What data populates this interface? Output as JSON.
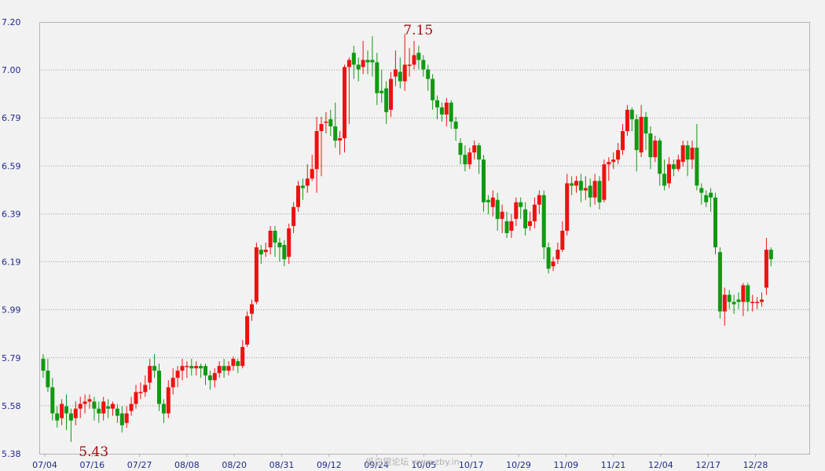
{
  "chart_data": {
    "type": "candlestick",
    "ylim": [
      5.38,
      7.2
    ],
    "yticks": [
      "7.20",
      "7.00",
      "6.79",
      "6.59",
      "6.39",
      "6.19",
      "5.99",
      "5.79",
      "5.58",
      "5.38"
    ],
    "xticks": [
      "07/04",
      "07/16",
      "07/27",
      "08/08",
      "08/20",
      "08/31",
      "09/12",
      "09/24",
      "10/05",
      "10/17",
      "10/29",
      "11/09",
      "11/21",
      "12/04",
      "12/17",
      "12/28"
    ],
    "grid": true,
    "up_color": "#ee1111",
    "down_color": "#119911",
    "annotations": [
      {
        "text": "7.15",
        "x": 77,
        "y": 7.15
      },
      {
        "text": "5.43",
        "x": 7,
        "y": 5.43
      }
    ],
    "candles": [
      [
        5.78,
        5.73,
        5.8,
        5.7
      ],
      [
        5.73,
        5.66,
        5.78,
        5.64
      ],
      [
        5.66,
        5.55,
        5.7,
        5.52
      ],
      [
        5.55,
        5.52,
        5.58,
        5.49
      ],
      [
        5.53,
        5.59,
        5.61,
        5.5
      ],
      [
        5.58,
        5.55,
        5.63,
        5.48
      ],
      [
        5.55,
        5.52,
        5.57,
        5.43
      ],
      [
        5.53,
        5.57,
        5.6,
        5.5
      ],
      [
        5.57,
        5.59,
        5.62,
        5.53
      ],
      [
        5.59,
        5.6,
        5.63,
        5.55
      ],
      [
        5.6,
        5.61,
        5.63,
        5.57
      ],
      [
        5.6,
        5.57,
        5.62,
        5.52
      ],
      [
        5.57,
        5.55,
        5.6,
        5.51
      ],
      [
        5.55,
        5.6,
        5.62,
        5.52
      ],
      [
        5.58,
        5.57,
        5.61,
        5.53
      ],
      [
        5.57,
        5.59,
        5.6,
        5.54
      ],
      [
        5.57,
        5.54,
        5.59,
        5.51
      ],
      [
        5.55,
        5.5,
        5.58,
        5.47
      ],
      [
        5.51,
        5.55,
        5.58,
        5.49
      ],
      [
        5.56,
        5.59,
        5.62,
        5.54
      ],
      [
        5.59,
        5.64,
        5.67,
        5.57
      ],
      [
        5.64,
        5.64,
        5.68,
        5.61
      ],
      [
        5.64,
        5.67,
        5.71,
        5.62
      ],
      [
        5.68,
        5.75,
        5.78,
        5.65
      ],
      [
        5.75,
        5.73,
        5.8,
        5.7
      ],
      [
        5.73,
        5.59,
        5.76,
        5.56
      ],
      [
        5.59,
        5.55,
        5.61,
        5.51
      ],
      [
        5.55,
        5.66,
        5.69,
        5.53
      ],
      [
        5.66,
        5.7,
        5.74,
        5.63
      ],
      [
        5.7,
        5.73,
        5.75,
        5.66
      ],
      [
        5.73,
        5.75,
        5.78,
        5.69
      ],
      [
        5.75,
        5.75,
        5.77,
        5.7
      ],
      [
        5.75,
        5.74,
        5.78,
        5.71
      ],
      [
        5.74,
        5.75,
        5.77,
        5.71
      ],
      [
        5.75,
        5.74,
        5.76,
        5.7
      ],
      [
        5.75,
        5.71,
        5.76,
        5.67
      ],
      [
        5.71,
        5.69,
        5.73,
        5.65
      ],
      [
        5.69,
        5.72,
        5.74,
        5.66
      ],
      [
        5.72,
        5.75,
        5.77,
        5.7
      ],
      [
        5.75,
        5.73,
        5.78,
        5.7
      ],
      [
        5.73,
        5.75,
        5.77,
        5.71
      ],
      [
        5.75,
        5.78,
        5.79,
        5.73
      ],
      [
        5.77,
        5.75,
        5.78,
        5.72
      ],
      [
        5.75,
        5.83,
        5.86,
        5.74
      ],
      [
        5.84,
        5.96,
        5.98,
        5.83
      ],
      [
        5.97,
        6.01,
        6.03,
        5.94
      ],
      [
        6.02,
        6.25,
        6.27,
        6.01
      ],
      [
        6.24,
        6.22,
        6.26,
        6.18
      ],
      [
        6.23,
        6.24,
        6.27,
        6.21
      ],
      [
        6.25,
        6.32,
        6.34,
        6.22
      ],
      [
        6.32,
        6.27,
        6.34,
        6.21
      ],
      [
        6.27,
        6.25,
        6.29,
        6.19
      ],
      [
        6.26,
        6.2,
        6.28,
        6.17
      ],
      [
        6.21,
        6.33,
        6.35,
        6.18
      ],
      [
        6.34,
        6.42,
        6.44,
        6.31
      ],
      [
        6.42,
        6.51,
        6.53,
        6.4
      ],
      [
        6.51,
        6.5,
        6.54,
        6.45
      ],
      [
        6.51,
        6.54,
        6.6,
        6.48
      ],
      [
        6.54,
        6.58,
        6.64,
        6.53
      ],
      [
        6.58,
        6.74,
        6.8,
        6.48
      ],
      [
        6.74,
        6.77,
        6.8,
        6.55
      ],
      [
        6.78,
        6.78,
        6.82,
        6.73
      ],
      [
        6.79,
        6.76,
        6.83,
        6.72
      ],
      [
        6.76,
        6.7,
        6.86,
        6.67
      ],
      [
        6.7,
        6.71,
        6.74,
        6.64
      ],
      [
        6.71,
        7.01,
        7.02,
        6.65
      ],
      [
        7.01,
        7.04,
        7.05,
        6.77
      ],
      [
        7.07,
        7.02,
        7.1,
        6.96
      ],
      [
        7.02,
        7.0,
        7.05,
        6.95
      ],
      [
        7.01,
        7.04,
        7.12,
        6.98
      ],
      [
        7.04,
        7.03,
        7.08,
        6.98
      ],
      [
        7.04,
        7.03,
        7.14,
        6.97
      ],
      [
        7.03,
        6.9,
        7.07,
        6.85
      ],
      [
        6.91,
        6.9,
        7.0,
        6.86
      ],
      [
        6.92,
        6.82,
        6.95,
        6.77
      ],
      [
        6.83,
        6.96,
        6.99,
        6.8
      ],
      [
        6.97,
        7.0,
        7.08,
        6.93
      ],
      [
        6.99,
        6.95,
        7.05,
        6.92
      ],
      [
        6.95,
        7.02,
        7.15,
        6.91
      ],
      [
        7.02,
        7.02,
        7.09,
        6.97
      ],
      [
        7.02,
        7.06,
        7.12,
        7.0
      ],
      [
        7.07,
        7.04,
        7.1,
        7.0
      ],
      [
        7.04,
        7.0,
        7.06,
        6.97
      ],
      [
        7.0,
        6.96,
        7.02,
        6.91
      ],
      [
        6.96,
        6.87,
        6.98,
        6.83
      ],
      [
        6.87,
        6.84,
        6.89,
        6.79
      ],
      [
        6.84,
        6.81,
        6.86,
        6.78
      ],
      [
        6.81,
        6.86,
        6.88,
        6.76
      ],
      [
        6.86,
        6.78,
        6.87,
        6.75
      ],
      [
        6.78,
        6.75,
        6.8,
        6.7
      ],
      [
        6.69,
        6.64,
        6.71,
        6.6
      ],
      [
        6.64,
        6.6,
        6.68,
        6.57
      ],
      [
        6.6,
        6.65,
        6.67,
        6.58
      ],
      [
        6.65,
        6.68,
        6.7,
        6.62
      ],
      [
        6.68,
        6.62,
        6.69,
        6.56
      ],
      [
        6.62,
        6.44,
        6.64,
        6.4
      ],
      [
        6.45,
        6.44,
        6.47,
        6.39
      ],
      [
        6.42,
        6.46,
        6.49,
        6.38
      ],
      [
        6.45,
        6.37,
        6.48,
        6.32
      ],
      [
        6.37,
        6.4,
        6.43,
        6.31
      ],
      [
        6.36,
        6.31,
        6.4,
        6.29
      ],
      [
        6.32,
        6.36,
        6.39,
        6.29
      ],
      [
        6.37,
        6.44,
        6.46,
        6.34
      ],
      [
        6.44,
        6.42,
        6.46,
        6.37
      ],
      [
        6.41,
        6.33,
        6.44,
        6.3
      ],
      [
        6.34,
        6.36,
        6.4,
        6.32
      ],
      [
        6.36,
        6.43,
        6.46,
        6.33
      ],
      [
        6.43,
        6.47,
        6.49,
        6.39
      ],
      [
        6.47,
        6.25,
        6.49,
        6.2
      ],
      [
        6.25,
        6.16,
        6.27,
        6.14
      ],
      [
        6.17,
        6.19,
        6.21,
        6.15
      ],
      [
        6.2,
        6.24,
        6.27,
        6.18
      ],
      [
        6.24,
        6.32,
        6.36,
        6.23
      ],
      [
        6.32,
        6.52,
        6.56,
        6.3
      ],
      [
        6.52,
        6.51,
        6.55,
        6.47
      ],
      [
        6.51,
        6.53,
        6.55,
        6.48
      ],
      [
        6.53,
        6.49,
        6.56,
        6.44
      ],
      [
        6.49,
        6.5,
        6.55,
        6.45
      ],
      [
        6.51,
        6.46,
        6.54,
        6.42
      ],
      [
        6.46,
        6.53,
        6.56,
        6.43
      ],
      [
        6.53,
        6.44,
        6.55,
        6.41
      ],
      [
        6.45,
        6.6,
        6.62,
        6.44
      ],
      [
        6.6,
        6.61,
        6.63,
        6.53
      ],
      [
        6.61,
        6.62,
        6.65,
        6.58
      ],
      [
        6.62,
        6.66,
        6.69,
        6.6
      ],
      [
        6.66,
        6.74,
        6.77,
        6.64
      ],
      [
        6.74,
        6.83,
        6.85,
        6.72
      ],
      [
        6.83,
        6.79,
        6.84,
        6.74
      ],
      [
        6.79,
        6.66,
        6.81,
        6.57
      ],
      [
        6.65,
        6.8,
        6.85,
        6.63
      ],
      [
        6.8,
        6.73,
        6.82,
        6.66
      ],
      [
        6.73,
        6.63,
        6.76,
        6.58
      ],
      [
        6.63,
        6.7,
        6.72,
        6.61
      ],
      [
        6.7,
        6.56,
        6.71,
        6.51
      ],
      [
        6.56,
        6.51,
        6.62,
        6.49
      ],
      [
        6.52,
        6.6,
        6.63,
        6.5
      ],
      [
        6.6,
        6.58,
        6.62,
        6.55
      ],
      [
        6.58,
        6.62,
        6.64,
        6.57
      ],
      [
        6.61,
        6.68,
        6.7,
        6.59
      ],
      [
        6.68,
        6.62,
        6.7,
        6.55
      ],
      [
        6.62,
        6.67,
        6.7,
        6.58
      ],
      [
        6.67,
        6.51,
        6.77,
        6.49
      ],
      [
        6.5,
        6.48,
        6.52,
        6.43
      ],
      [
        6.47,
        6.44,
        6.49,
        6.42
      ],
      [
        6.48,
        6.46,
        6.5,
        6.4
      ],
      [
        6.46,
        6.25,
        6.48,
        6.22
      ],
      [
        6.23,
        5.98,
        6.25,
        5.95
      ],
      [
        5.98,
        6.05,
        6.08,
        5.92
      ],
      [
        6.05,
        6.02,
        6.07,
        5.99
      ],
      [
        6.02,
        6.01,
        6.05,
        5.97
      ],
      [
        6.03,
        6.02,
        6.06,
        5.99
      ],
      [
        6.02,
        6.09,
        6.1,
        5.96
      ],
      [
        6.09,
        6.02,
        6.1,
        5.98
      ],
      [
        6.02,
        6.02,
        6.05,
        5.98
      ],
      [
        6.02,
        6.02,
        6.04,
        5.99
      ],
      [
        6.02,
        6.03,
        6.06,
        6.0
      ],
      [
        6.08,
        6.24,
        6.29,
        6.05
      ],
      [
        6.24,
        6.2,
        6.25,
        6.17
      ]
    ]
  },
  "watermark": "纸白银论坛 www.zby.in"
}
